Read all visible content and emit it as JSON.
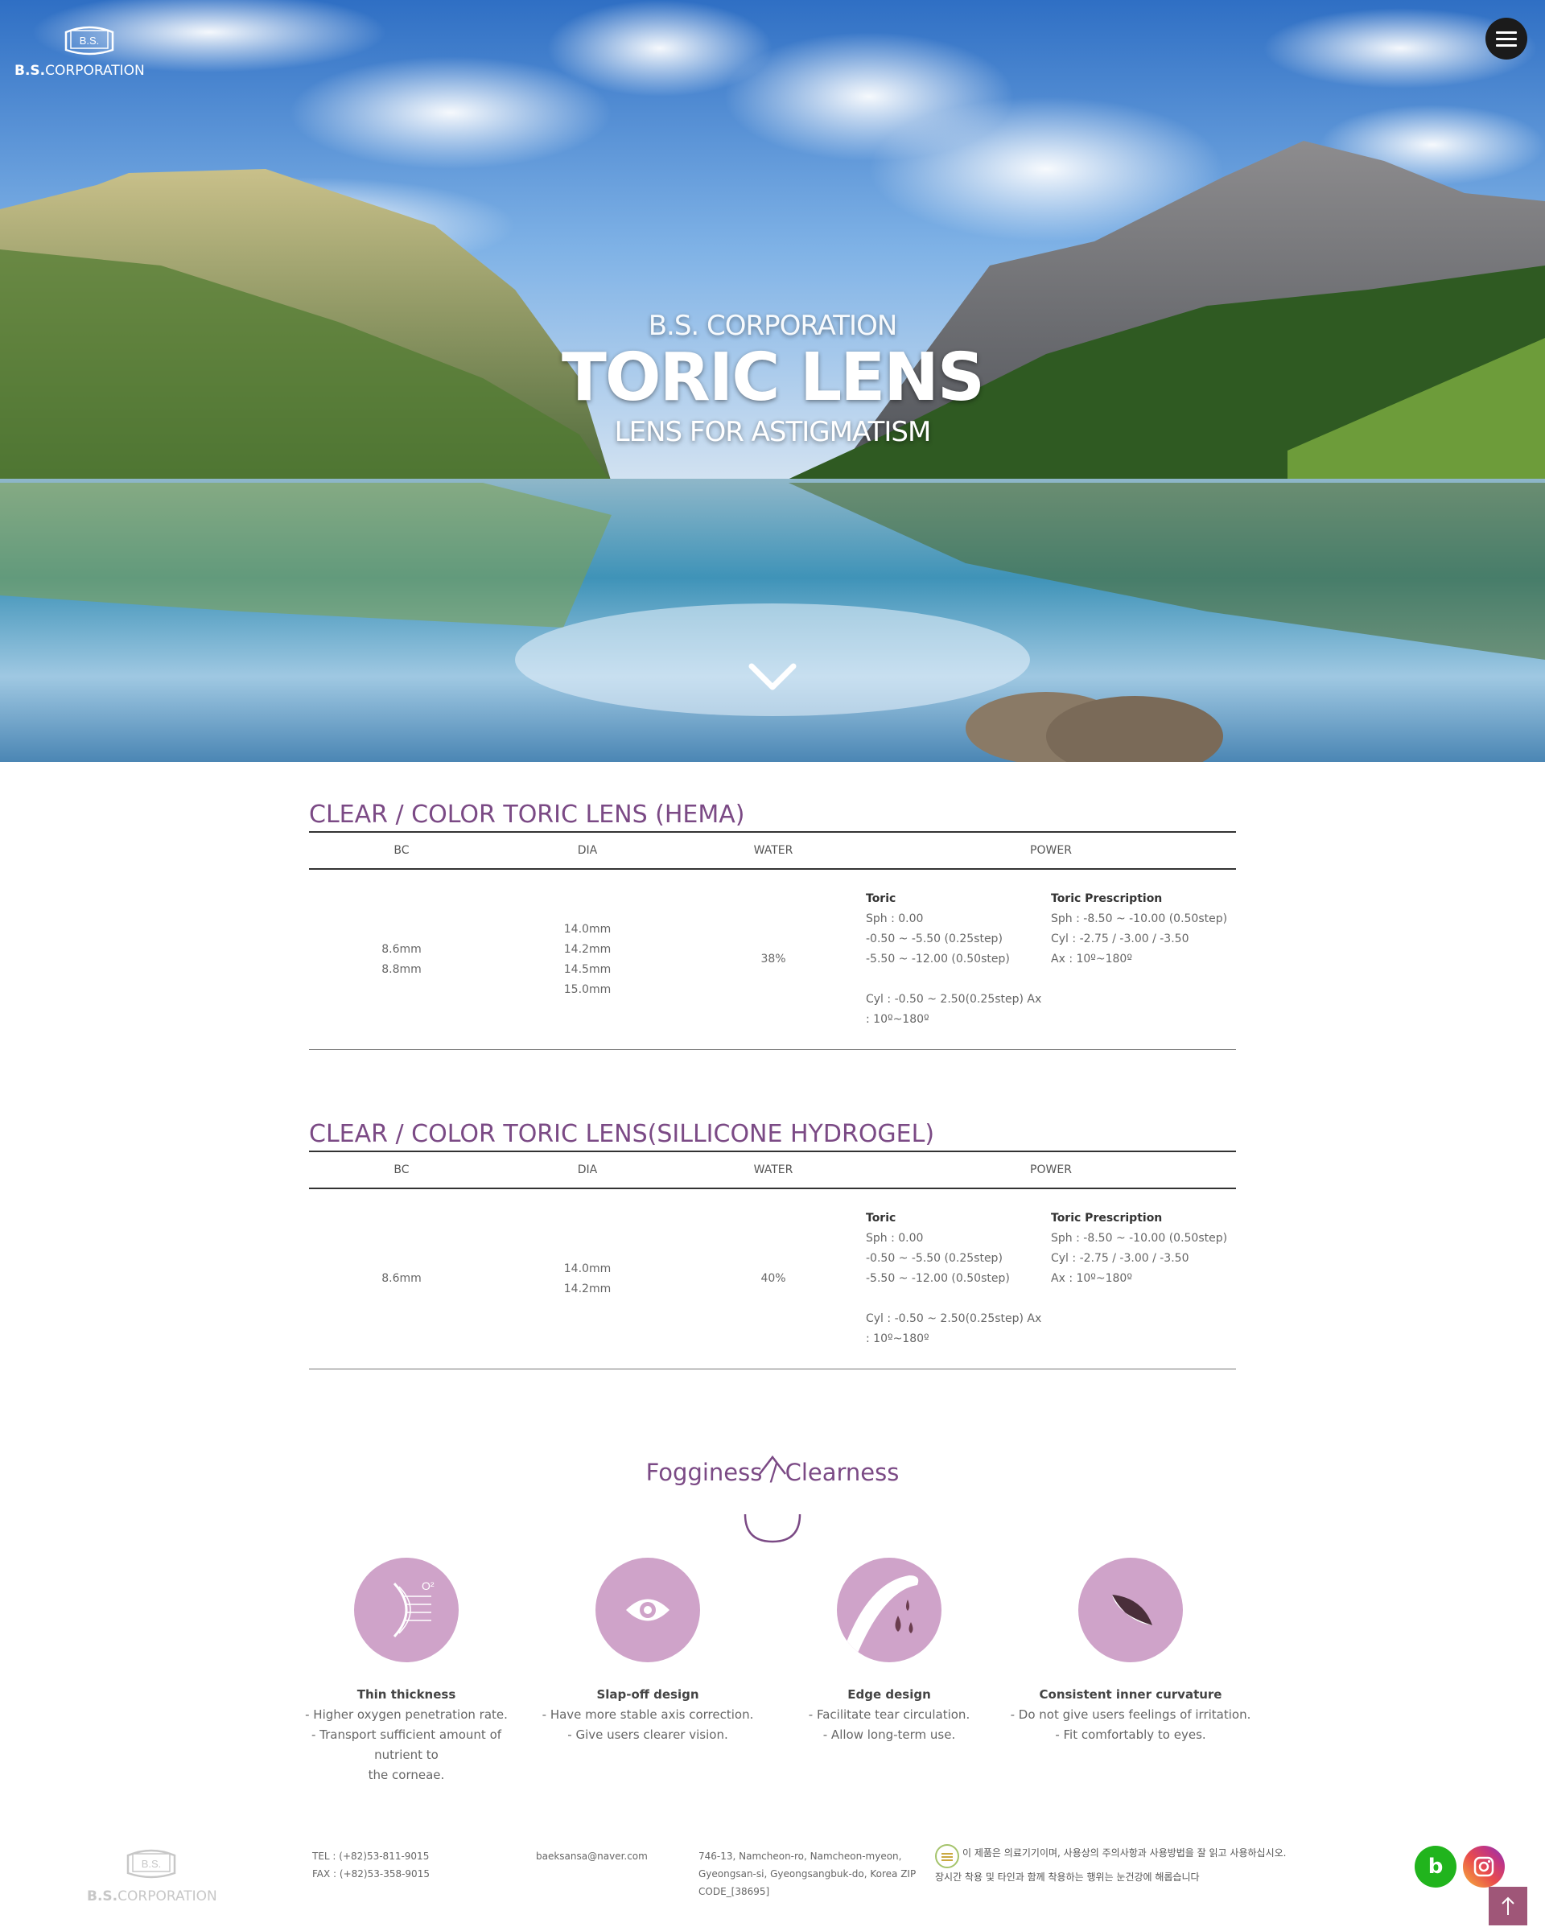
{
  "header": {
    "logo_mark": "B.S.",
    "logo_text_bold": "B.S.",
    "logo_text": "CORPORATION",
    "menu_icon": "hamburger-icon"
  },
  "hero": {
    "subtitle": "B.S. CORPORATION",
    "title": "TORIC LENS",
    "tagline": "LENS FOR ASTIGMATISM",
    "scroll_icon": "chevron-down-icon"
  },
  "tables": [
    {
      "title": "CLEAR / COLOR TORIC LENS (HEMA)",
      "headers": [
        "BC",
        "DIA",
        "WATER",
        "POWER"
      ],
      "bc": [
        "8.6mm",
        "8.8mm"
      ],
      "dia": [
        "14.0mm",
        "14.2mm",
        "14.5mm",
        "15.0mm"
      ],
      "water": "38%",
      "toric": {
        "heading": "Toric",
        "lines": [
          "Sph : 0.00",
          "-0.50 ~ -5.50 (0.25step)",
          "-5.50 ~ -12.00 (0.50step)",
          "",
          "Cyl : -0.50 ~ 2.50(0.25step) Ax",
          ": 10º~180º"
        ]
      },
      "prescription": {
        "heading": "Toric Prescription",
        "lines": [
          "Sph : -8.50 ~ -10.00 (0.50step)",
          "Cyl : -2.75 / -3.00 / -3.50",
          "Ax : 10º~180º"
        ]
      }
    },
    {
      "title": "CLEAR / COLOR TORIC LENS(SILLICONE HYDROGEL)",
      "headers": [
        "BC",
        "DIA",
        "WATER",
        "POWER"
      ],
      "bc": [
        "8.6mm"
      ],
      "dia": [
        "14.0mm",
        "14.2mm"
      ],
      "water": "40%",
      "toric": {
        "heading": "Toric",
        "lines": [
          "Sph : 0.00",
          "-0.50 ~ -5.50 (0.25step)",
          "-5.50 ~ -12.00 (0.50step)",
          "",
          "Cyl : -0.50 ~ 2.50(0.25step) Ax",
          ": 10º~180º"
        ]
      },
      "prescription": {
        "heading": "Toric Prescription",
        "lines": [
          "Sph : -8.50 ~ -10.00 (0.50step)",
          "Cyl : -2.75 / -3.00 / -3.50",
          "Ax : 10º~180º"
        ]
      }
    }
  ],
  "features_title": "Fogginess / Clearness",
  "features": [
    {
      "icon": "oxygen-lens-icon",
      "icon_label": "O²",
      "name": "Thin thickness",
      "desc": [
        "- Higher oxygen penetration rate.",
        "- Transport sufficient amount of nutrient to",
        "the corneae."
      ]
    },
    {
      "icon": "eye-icon",
      "name": "Slap-off design",
      "desc": [
        "- Have more stable axis correction.",
        "- Give users clearer vision."
      ]
    },
    {
      "icon": "tear-drop-icon",
      "name": "Edge design",
      "desc": [
        "- Facilitate tear circulation.",
        "- Allow long-term use."
      ]
    },
    {
      "icon": "lens-curve-icon",
      "name": "Consistent inner curvature",
      "desc": [
        "- Do not give users feelings of irritation.",
        "- Fit comfortably to eyes."
      ]
    }
  ],
  "footer": {
    "logo_mark": "B.S.",
    "logo_text_bold": "B.S.",
    "logo_text": "CORPORATION",
    "tel": "TEL : (+82)53-811-9015",
    "fax": "FAX : (+82)53-358-9015",
    "email": "baeksansa@naver.com",
    "address": [
      "746-13, Namcheon-ro, Namcheon-myeon,",
      "Gyeongsan-si, Gyeongsangbuk-do, Korea ZIP",
      "CODE_[38695]"
    ],
    "notice": "이 제품은 의료기기이며, 사용상의 주의사항과 사용방법을 잘 읽고 사용하십시오. 장시간 착용 및 타인과 함께 착용하는 행위는 눈건강에 해롭습니다",
    "sns_blog": "b",
    "instagram_icon": "instagram-icon",
    "top_icon": "arrow-up-icon"
  }
}
